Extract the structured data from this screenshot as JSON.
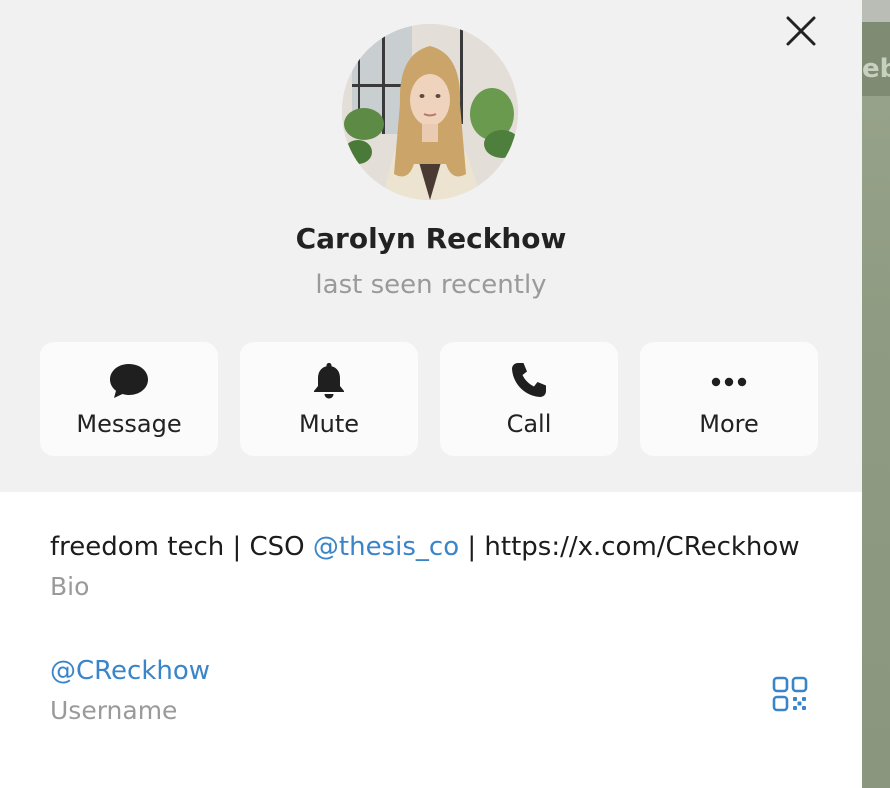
{
  "profile": {
    "name": "Carolyn Reckhow",
    "status": "last seen recently"
  },
  "actions": [
    {
      "label": "Message",
      "icon": "chat-bubble-icon"
    },
    {
      "label": "Mute",
      "icon": "bell-icon"
    },
    {
      "label": "Call",
      "icon": "phone-icon"
    },
    {
      "label": "More",
      "icon": "ellipsis-icon"
    }
  ],
  "bio": {
    "text_before": "freedom tech | CSO ",
    "mention": "@thesis_co",
    "text_after": " | https://x.com/CReckhow",
    "label": "Bio"
  },
  "username": {
    "value": "@CReckhow",
    "label": "Username"
  },
  "background": {
    "partial_title": "eb"
  },
  "colors": {
    "accent": "#3a85c9",
    "top_background": "#f1f1f1",
    "button_background": "#fbfbfb",
    "muted_text": "#9a9a9a"
  }
}
